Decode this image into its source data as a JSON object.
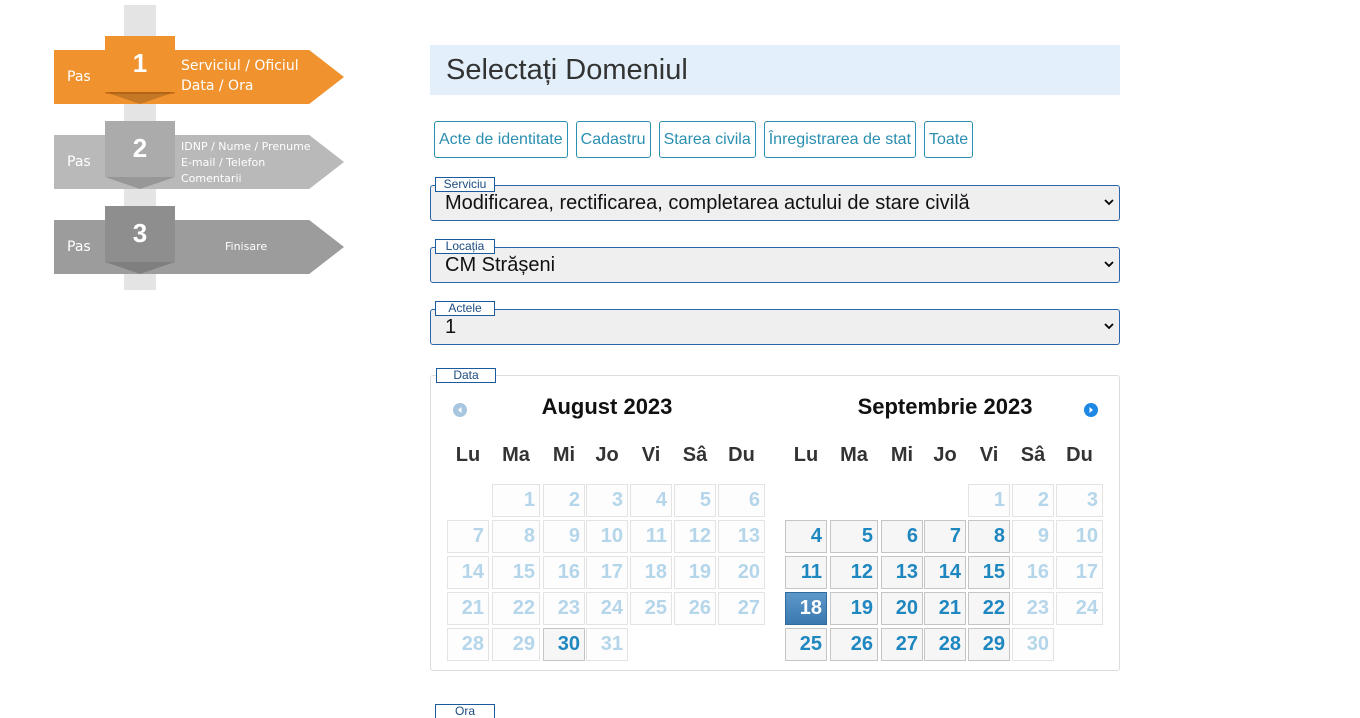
{
  "steps": [
    {
      "pas": "Pas",
      "num": "1",
      "lines": [
        "Serviciul / Oficiul",
        "Data / Ora"
      ]
    },
    {
      "pas": "Pas",
      "num": "2",
      "lines": [
        "IDNP / Nume / Prenume",
        "E-mail / Telefon",
        "Comentarii"
      ]
    },
    {
      "pas": "Pas",
      "num": "3",
      "lines": [
        "Finisare"
      ]
    }
  ],
  "main": {
    "title": "Selectați Domeniul",
    "domains": [
      "Acte de identitate",
      "Cadastru",
      "Starea civila",
      "Înregistrarea de stat",
      "Toate"
    ],
    "serviciu": {
      "label": "Serviciu",
      "value": "Modificarea, rectificarea, completarea actului de stare civilă"
    },
    "locatia": {
      "label": "Locația",
      "value": "CM Strășeni"
    },
    "actele": {
      "label": "Actele",
      "value": "1"
    },
    "data_label": "Data",
    "ora_label": "Ora"
  },
  "calendar": {
    "weekdays": [
      "Lu",
      "Ma",
      "Mi",
      "Jo",
      "Vi",
      "Sâ",
      "Du"
    ],
    "months": [
      {
        "title": "August 2023",
        "first_weekday": 1,
        "days": 31,
        "active": [
          30
        ],
        "today": null
      },
      {
        "title": "Septembrie 2023",
        "first_weekday": 4,
        "days": 30,
        "active": [
          4,
          5,
          6,
          7,
          8,
          11,
          12,
          13,
          14,
          15,
          18,
          19,
          20,
          21,
          22,
          25,
          26,
          27,
          28,
          29
        ],
        "today": 18
      }
    ],
    "colors": {
      "disabled": "#b5d6ea",
      "active": "#1f87c0",
      "today_bg": "#3a79b0"
    }
  }
}
